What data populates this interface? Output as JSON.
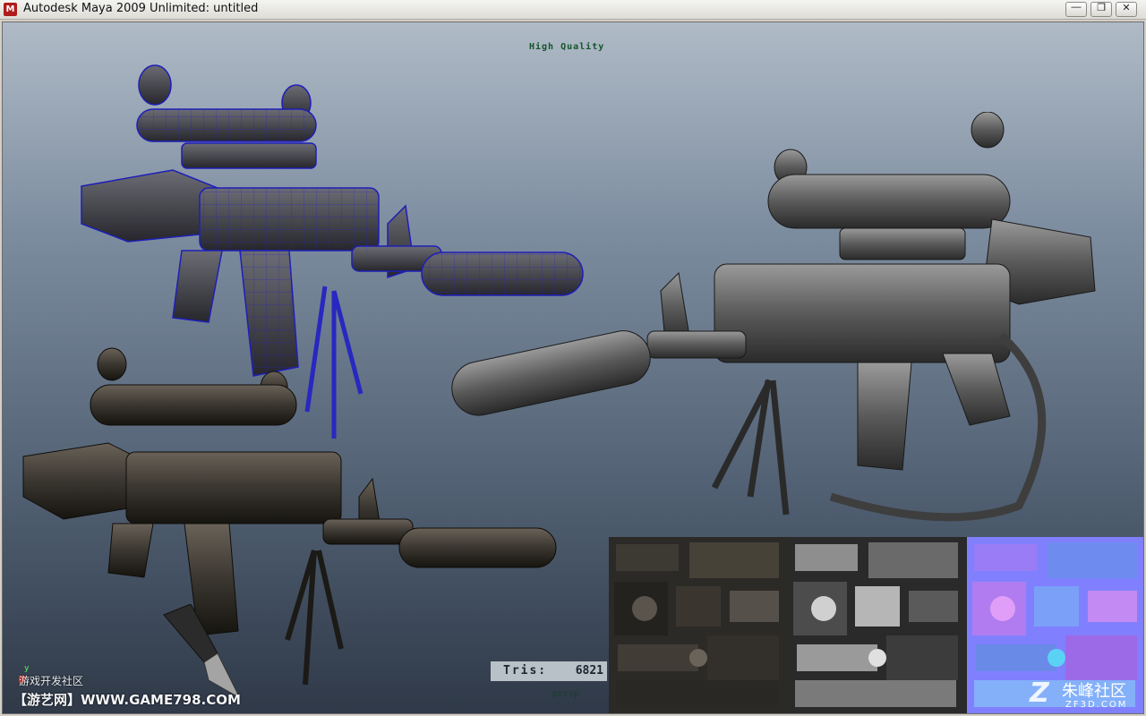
{
  "window": {
    "title": "Autodesk Maya 2009 Unlimited: untitled",
    "app_icon": "maya-icon",
    "buttons": [
      "minimize-icon",
      "restore-icon",
      "close-icon"
    ]
  },
  "viewport": {
    "quality_label": "High Quality",
    "tris_label": "Tris:",
    "tris_value": "6821",
    "camera": "persp",
    "axis_label": "y"
  },
  "models": [
    "wireframe-on-shaded-rifle",
    "shaded-rifle",
    "textured-rifle",
    "knife"
  ],
  "textures": [
    "diffuse-texture-map",
    "specular-texture-map",
    "normal-texture-map"
  ],
  "watermarks": {
    "community": "游戏开发社区",
    "site": "【游艺网】WWW.GAME798.COM",
    "logo_cn": "朱峰社区",
    "logo_en": "ZF3D.COM"
  },
  "colors": {
    "viewport_top": "#afbac6",
    "viewport_bottom": "#2f3948",
    "wireframe": "#2a2acc",
    "hq_text": "#14532a"
  }
}
